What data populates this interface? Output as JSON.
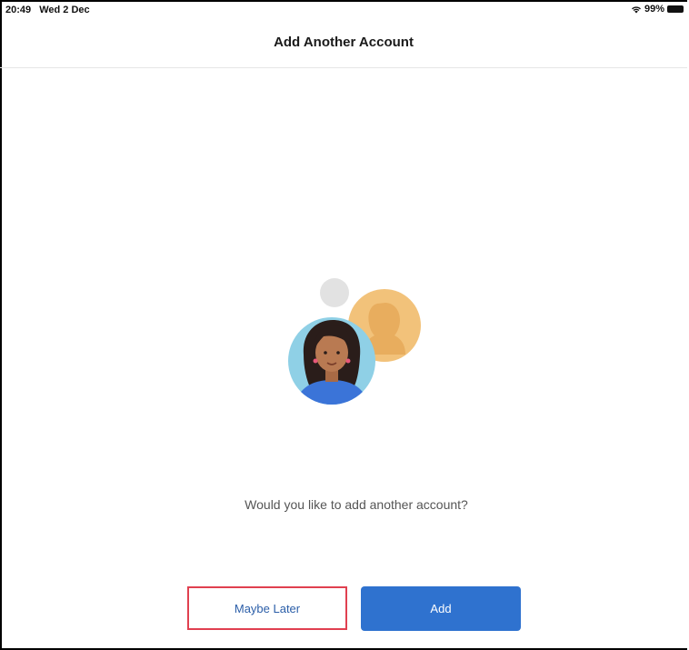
{
  "status_bar": {
    "time": "20:49",
    "date": "Wed 2 Dec",
    "battery": "99%",
    "wifi_icon": "wifi-icon",
    "battery_icon": "battery-icon"
  },
  "header": {
    "title": "Add Another Account"
  },
  "main": {
    "prompt": "Would you like to add another account?",
    "illustration": "accounts-illustration"
  },
  "actions": {
    "maybe_later_label": "Maybe Later",
    "add_label": "Add"
  },
  "colors": {
    "primary": "#2f72cf",
    "link": "#2b5ea8",
    "highlight_border": "#e04050"
  }
}
